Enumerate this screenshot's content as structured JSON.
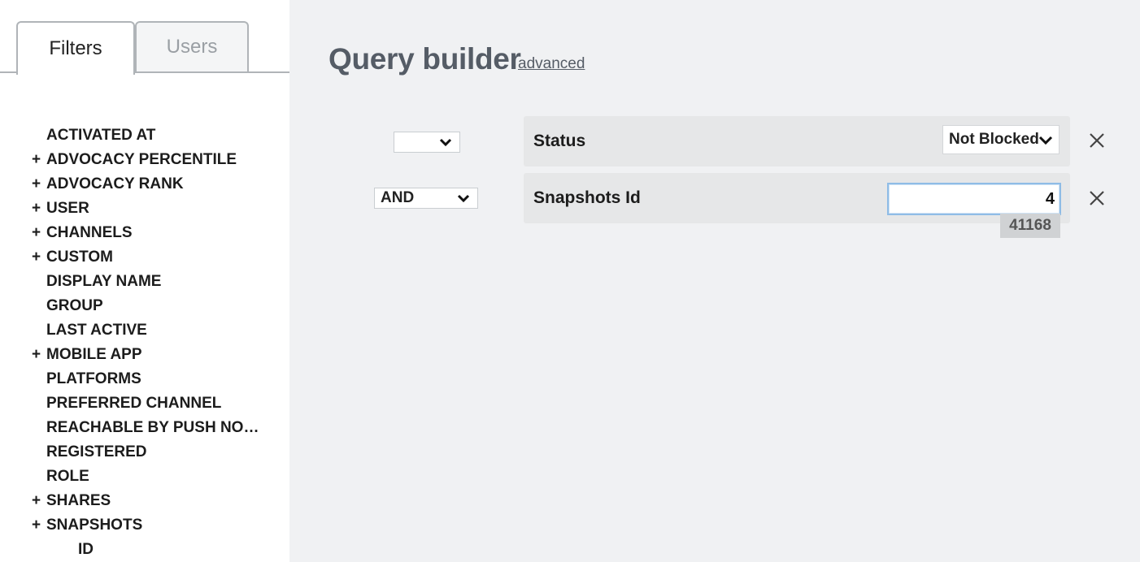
{
  "sidebar": {
    "tabs": [
      {
        "label": "Filters",
        "active": true
      },
      {
        "label": "Users",
        "active": false
      }
    ],
    "fields": [
      {
        "label": "ACTIVATED AT",
        "expandable": false
      },
      {
        "label": "ADVOCACY PERCENTILE",
        "expandable": true
      },
      {
        "label": "ADVOCACY RANK",
        "expandable": true
      },
      {
        "label": "USER",
        "expandable": true
      },
      {
        "label": "CHANNELS",
        "expandable": true
      },
      {
        "label": "CUSTOM",
        "expandable": true
      },
      {
        "label": "DISPLAY NAME",
        "expandable": false
      },
      {
        "label": "GROUP",
        "expandable": false
      },
      {
        "label": "LAST ACTIVE",
        "expandable": false
      },
      {
        "label": "MOBILE APP",
        "expandable": true
      },
      {
        "label": "PLATFORMS",
        "expandable": false
      },
      {
        "label": "PREFERRED CHANNEL",
        "expandable": false
      },
      {
        "label": "REACHABLE BY PUSH NOTI...",
        "expandable": false
      },
      {
        "label": "REGISTERED",
        "expandable": false
      },
      {
        "label": "ROLE",
        "expandable": false
      },
      {
        "label": "SHARES",
        "expandable": true
      },
      {
        "label": "SNAPSHOTS",
        "expandable": true
      },
      {
        "label": "ID",
        "expandable": false,
        "child": true
      }
    ],
    "expand_symbol": "+"
  },
  "main": {
    "title": "Query builder",
    "advanced_link": "advanced",
    "conditions": [
      {
        "conjunction": "",
        "field": "Status",
        "value_select": "Not Blocked"
      },
      {
        "conjunction": "AND",
        "field": "Snapshots Id",
        "value_input": "4",
        "suggestion": "41168"
      }
    ]
  },
  "colors": {
    "title": "#555c66",
    "input_focus_border": "#8fbce6",
    "main_bg": "#f0f1f3",
    "row_bg": "#e6e7e8"
  }
}
